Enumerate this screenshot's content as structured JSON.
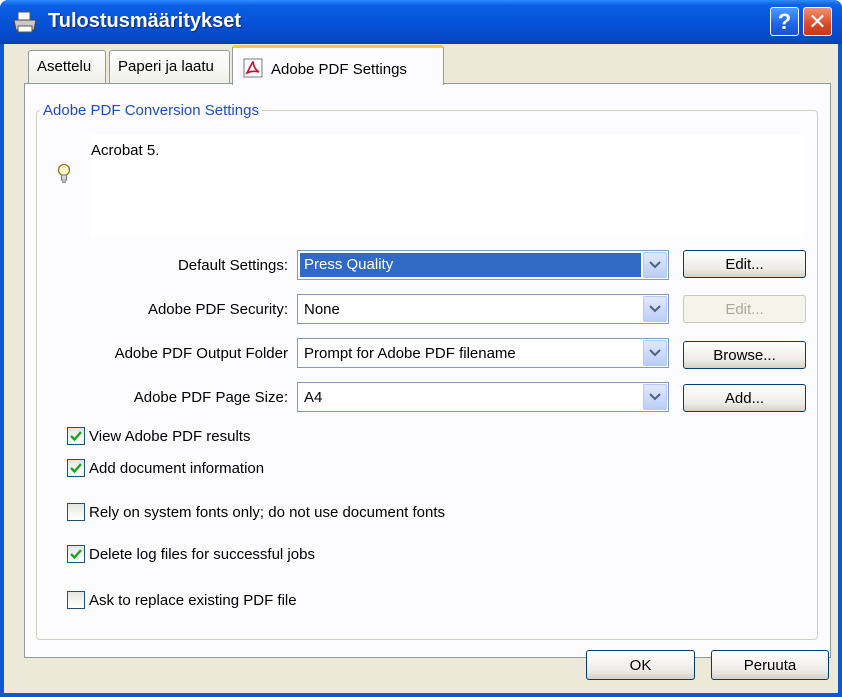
{
  "window": {
    "title": "Tulostusmääritykset",
    "help_label": "?",
    "close_label": "✕"
  },
  "tabs": [
    {
      "label": "Asettelu"
    },
    {
      "label": "Paperi ja laatu"
    },
    {
      "label": "Adobe PDF Settings"
    }
  ],
  "group": {
    "legend": "Adobe PDF Conversion Settings",
    "description": "Acrobat 5."
  },
  "fields": {
    "default_settings": {
      "label": "Default Settings:",
      "value": "Press Quality",
      "button": "Edit..."
    },
    "security": {
      "label": "Adobe PDF Security:",
      "value": "None",
      "button": "Edit..."
    },
    "output_folder": {
      "label": "Adobe PDF Output Folder",
      "value": "Prompt for Adobe PDF filename",
      "button": "Browse..."
    },
    "page_size": {
      "label": "Adobe PDF Page Size:",
      "value": "A4",
      "button": "Add..."
    }
  },
  "checkboxes": [
    {
      "label": "View Adobe PDF results",
      "checked": true
    },
    {
      "label": "Add document information",
      "checked": true
    },
    {
      "label": "Rely on system fonts only; do not use document fonts",
      "checked": false
    },
    {
      "label": "Delete log files for successful jobs",
      "checked": true
    },
    {
      "label": "Ask to replace existing PDF file",
      "checked": false
    }
  ],
  "footer": {
    "ok": "OK",
    "cancel": "Peruuta"
  },
  "colors": {
    "titlebar": "#0551d6",
    "legend": "#1f4bc8",
    "selection": "#316ac5",
    "check": "#21a121"
  }
}
